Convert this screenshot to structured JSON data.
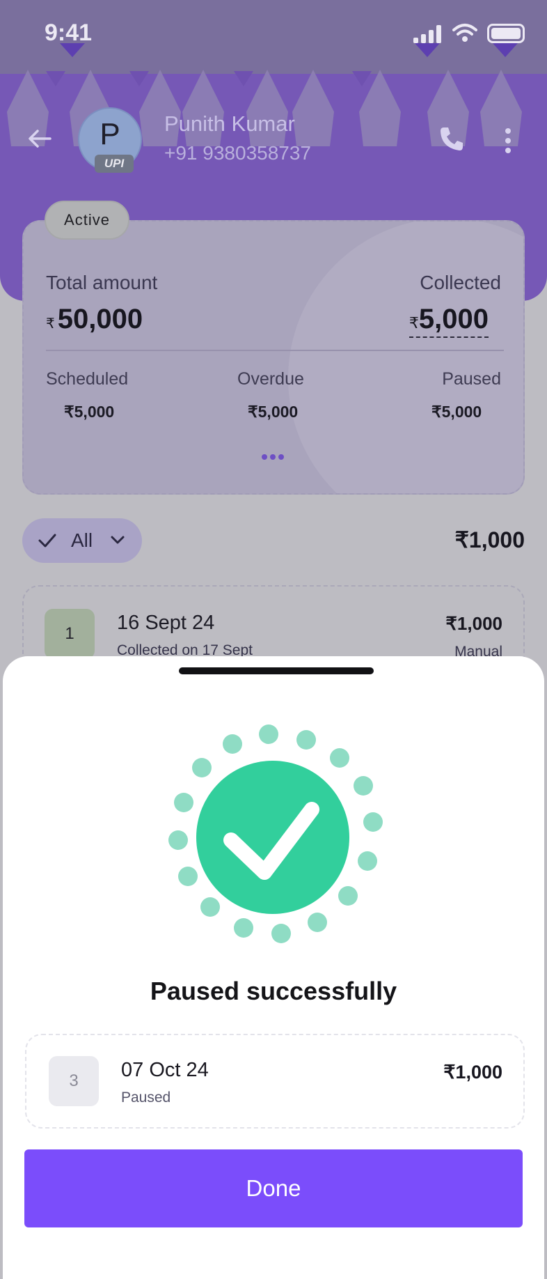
{
  "status_bar": {
    "time": "9:41"
  },
  "contact": {
    "initial": "P",
    "upi_badge": "UPI",
    "name": "Punith Kumar",
    "phone": "+91 9380358737"
  },
  "mandate": {
    "status_pill": "Active",
    "total_label": "Total amount",
    "total_currency": "₹",
    "total_value": "50,000",
    "collected_label": "Collected",
    "collected_currency": "₹",
    "collected_value": "5,000",
    "stats": [
      {
        "label": "Scheduled",
        "value": "₹5,000"
      },
      {
        "label": "Overdue",
        "value": "₹5,000"
      },
      {
        "label": "Paused",
        "value": "₹5,000"
      }
    ]
  },
  "filter": {
    "label": "All",
    "total": "₹1,000"
  },
  "list": [
    {
      "num": "1",
      "date": "16 Sept 24",
      "sub": "Collected on 17 Sept",
      "amount": "₹1,000",
      "mode": "Manual"
    }
  ],
  "sheet": {
    "title": "Paused successfully",
    "installment": {
      "num": "3",
      "date": "07 Oct 24",
      "status": "Paused",
      "amount": "₹1,000"
    },
    "done_label": "Done"
  },
  "colors": {
    "primary": "#7b4dfb",
    "header": "#7658b6",
    "success": "#32cf9c",
    "success_light": "#8fdcc4"
  },
  "icons": [
    "back-arrow-icon",
    "upi-icon",
    "phone-icon",
    "more-vertical-icon",
    "check-icon",
    "chevron-down-icon",
    "success-check-icon",
    "signal-icon",
    "wifi-icon",
    "battery-icon"
  ]
}
